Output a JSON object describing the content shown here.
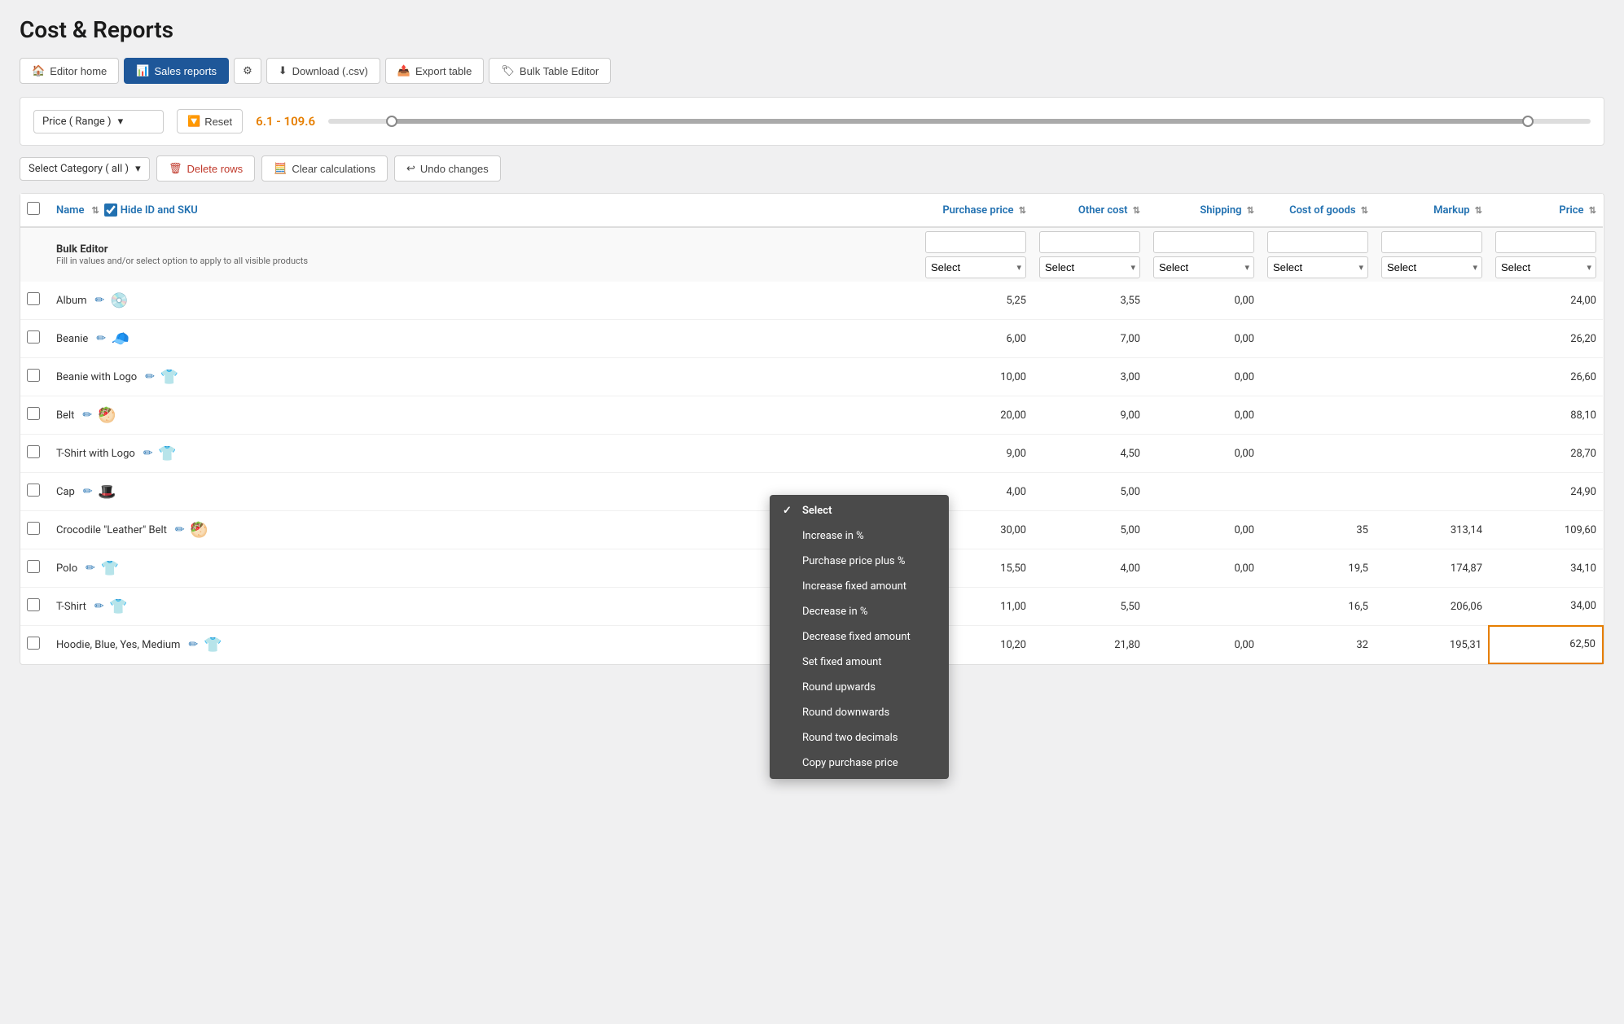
{
  "page": {
    "title": "Cost & Reports"
  },
  "toolbar": {
    "editor_home": "Editor home",
    "sales_reports": "Sales reports",
    "settings": "⚙",
    "download_csv": "Download (.csv)",
    "export_table": "Export table",
    "bulk_table_editor": "Bulk Table Editor"
  },
  "filter": {
    "price_range_label": "Price ( Range )",
    "reset_label": "Reset",
    "range_value": "6.1 - 109.6"
  },
  "actions": {
    "select_category": "Select Category ( all )",
    "delete_rows": "Delete rows",
    "clear_calculations": "Clear calculations",
    "undo_changes": "Undo changes"
  },
  "table": {
    "headers": {
      "name": "Name",
      "hide_id_sku": "Hide ID and SKU",
      "purchase_price": "Purchase price",
      "other_cost": "Other cost",
      "shipping": "Shipping",
      "cost_of_goods": "Cost of goods",
      "markup": "Markup",
      "price": "Price"
    },
    "bulk_editor": {
      "title": "Bulk Editor",
      "subtitle": "Fill in values and/or select option to apply to all visible products"
    },
    "select_placeholder": "Select",
    "products": [
      {
        "name": "Album",
        "icon": "💿",
        "purchase": "5,25",
        "other": "3,55",
        "shipping": "0,00",
        "cogs": "",
        "markup": "",
        "price": "24,00"
      },
      {
        "name": "Beanie",
        "icon": "🧢",
        "purchase": "6,00",
        "other": "7,00",
        "shipping": "0,00",
        "cogs": "",
        "markup": "",
        "price": "26,20"
      },
      {
        "name": "Beanie with Logo",
        "icon": "👕",
        "purchase": "10,00",
        "other": "3,00",
        "shipping": "0,00",
        "cogs": "",
        "markup": "",
        "price": "26,60"
      },
      {
        "name": "Belt",
        "icon": "🥙",
        "purchase": "20,00",
        "other": "9,00",
        "shipping": "0,00",
        "cogs": "",
        "markup": "",
        "price": "88,10"
      },
      {
        "name": "T-Shirt with Logo",
        "icon": "👕",
        "purchase": "9,00",
        "other": "4,50",
        "shipping": "0,00",
        "cogs": "",
        "markup": "",
        "price": "28,70"
      },
      {
        "name": "Cap",
        "icon": "🎩",
        "purchase": "4,00",
        "other": "5,00",
        "shipping": "",
        "cogs": "",
        "markup": "",
        "price": "24,90"
      },
      {
        "name": "Crocodile \"Leather\" Belt",
        "icon": "🥙",
        "purchase": "30,00",
        "other": "5,00",
        "shipping": "0,00",
        "cogs": "35",
        "markup": "313,14",
        "price": "109,60"
      },
      {
        "name": "Polo",
        "icon": "👕",
        "purchase": "15,50",
        "other": "4,00",
        "shipping": "0,00",
        "cogs": "19,5",
        "markup": "174,87",
        "price": "34,10"
      },
      {
        "name": "T-Shirt",
        "icon": "👕",
        "purchase": "11,00",
        "other": "5,50",
        "shipping": "",
        "cogs": "16,5",
        "markup": "206,06",
        "price": "34,00"
      },
      {
        "name": "Hoodie, Blue, Yes, Medium",
        "icon": "👕",
        "purchase": "10,20",
        "other": "21,80",
        "shipping": "0,00",
        "cogs": "32",
        "markup": "195,31",
        "price": "62,50",
        "highlight": true
      }
    ]
  },
  "dropdown": {
    "items": [
      {
        "label": "Select",
        "selected": true
      },
      {
        "label": "Increase in %",
        "selected": false
      },
      {
        "label": "Purchase price plus %",
        "selected": false
      },
      {
        "label": "Increase fixed amount",
        "selected": false
      },
      {
        "label": "Decrease in %",
        "selected": false
      },
      {
        "label": "Decrease fixed amount",
        "selected": false
      },
      {
        "label": "Set fixed amount",
        "selected": false
      },
      {
        "label": "Round upwards",
        "selected": false
      },
      {
        "label": "Round downwards",
        "selected": false
      },
      {
        "label": "Round two decimals",
        "selected": false
      },
      {
        "label": "Copy purchase price",
        "selected": false
      }
    ]
  }
}
